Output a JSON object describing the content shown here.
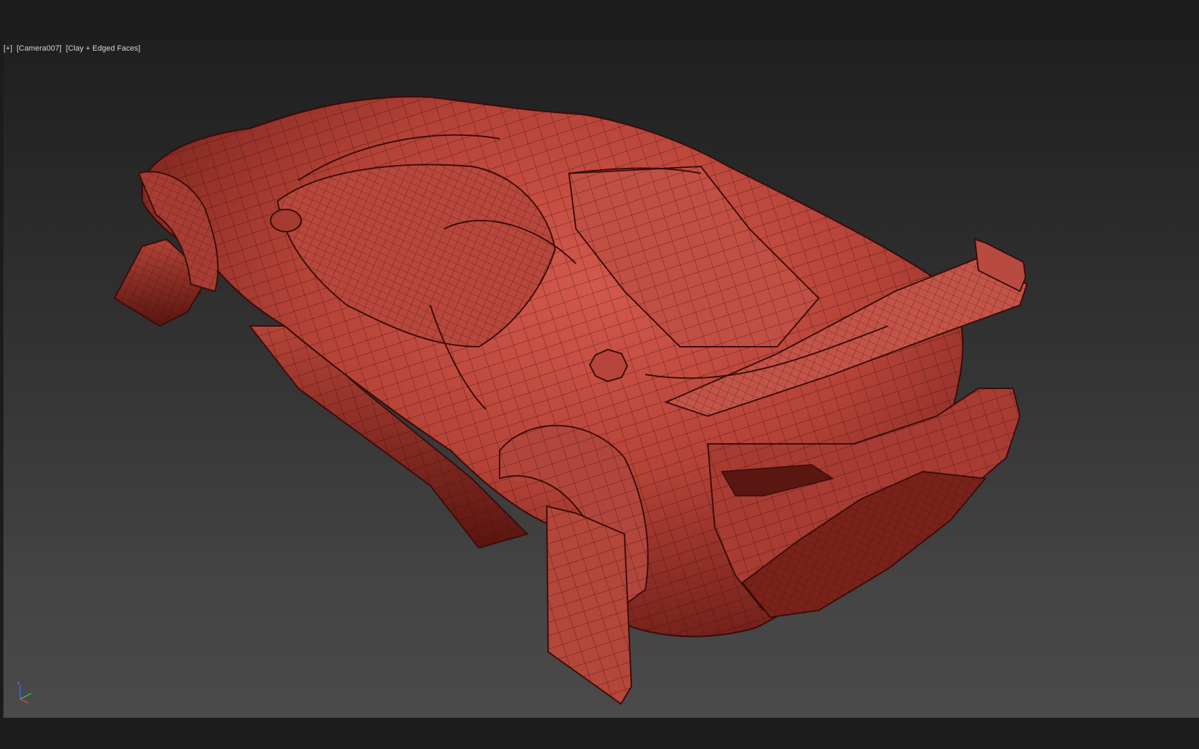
{
  "viewport": {
    "menu_plus": "[+]",
    "camera": "[Camera007]",
    "shading": "[Clay + Edged Faces]",
    "model": {
      "subject": "sports-car wireframe model",
      "clay_color": "#c04a40",
      "edge_color": "#3a0c0a"
    },
    "axis_gizmo": {
      "labels": [
        "z"
      ],
      "colors": {
        "x": "#e04040",
        "y": "#40c040",
        "z": "#4060ff"
      }
    }
  }
}
